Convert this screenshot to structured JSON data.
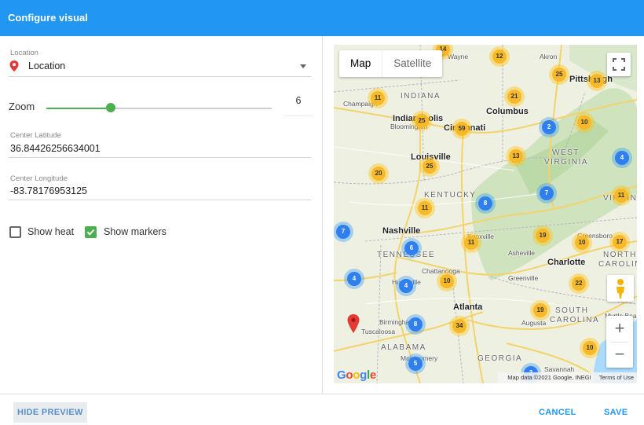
{
  "dialog": {
    "title": "Configure visual"
  },
  "location": {
    "label": "Location",
    "value": "Location",
    "icon": "location-pin-icon"
  },
  "zoom": {
    "label": "Zoom",
    "value": "6",
    "slider_fraction": 0.28
  },
  "center_latitude": {
    "label": "Center Latitude",
    "value": "36.84426256634001"
  },
  "center_longitude": {
    "label": "Center Longitude",
    "value": "-83.78176953125"
  },
  "options": {
    "show_heat": {
      "label": "Show heat",
      "checked": false
    },
    "show_markers": {
      "label": "Show markers",
      "checked": true
    }
  },
  "map": {
    "type_map": "Map",
    "type_satellite": "Satellite",
    "attribution": "Map data ©2021 Google, INEGI",
    "terms": "Terms of Use",
    "logo": "Google",
    "zoom_in": "+",
    "zoom_out": "−",
    "cities": [
      "INDIANA",
      "Indianapolis",
      "Columbus",
      "Akron",
      "Pittsburgh",
      "Wayne",
      "Champaign",
      "Bloomington",
      "Cincinnati",
      "Louisville",
      "WEST",
      "VIRGINIA",
      "KENTUCKY",
      "Nashville",
      "TENNESSEE",
      "Knoxville",
      "Asheville",
      "Charlotte",
      "Greensboro",
      "NORTH",
      "CAROLINA",
      "Chattanooga",
      "Huntsville",
      "Greenville",
      "Atlanta",
      "Birmingham",
      "Tuscaloosa",
      "ALABAMA",
      "Montgomery",
      "GEORGIA",
      "SOUTH",
      "CAROLINA",
      "Augusta",
      "Myrtle Beach",
      "Savannah",
      "VIRGINIA"
    ],
    "clusters": [
      "14",
      "12",
      "25",
      "13",
      "11",
      "21",
      "25",
      "59",
      "2",
      "10",
      "13",
      "25",
      "4",
      "20",
      "7",
      "11",
      "8",
      "11",
      "11",
      "19",
      "17",
      "10",
      "7",
      "6",
      "10",
      "4",
      "4",
      "22",
      "19",
      "8",
      "34",
      "10",
      "5",
      "3"
    ]
  },
  "footer": {
    "hide_preview": "HIDE PREVIEW",
    "cancel": "CANCEL",
    "save": "SAVE"
  }
}
